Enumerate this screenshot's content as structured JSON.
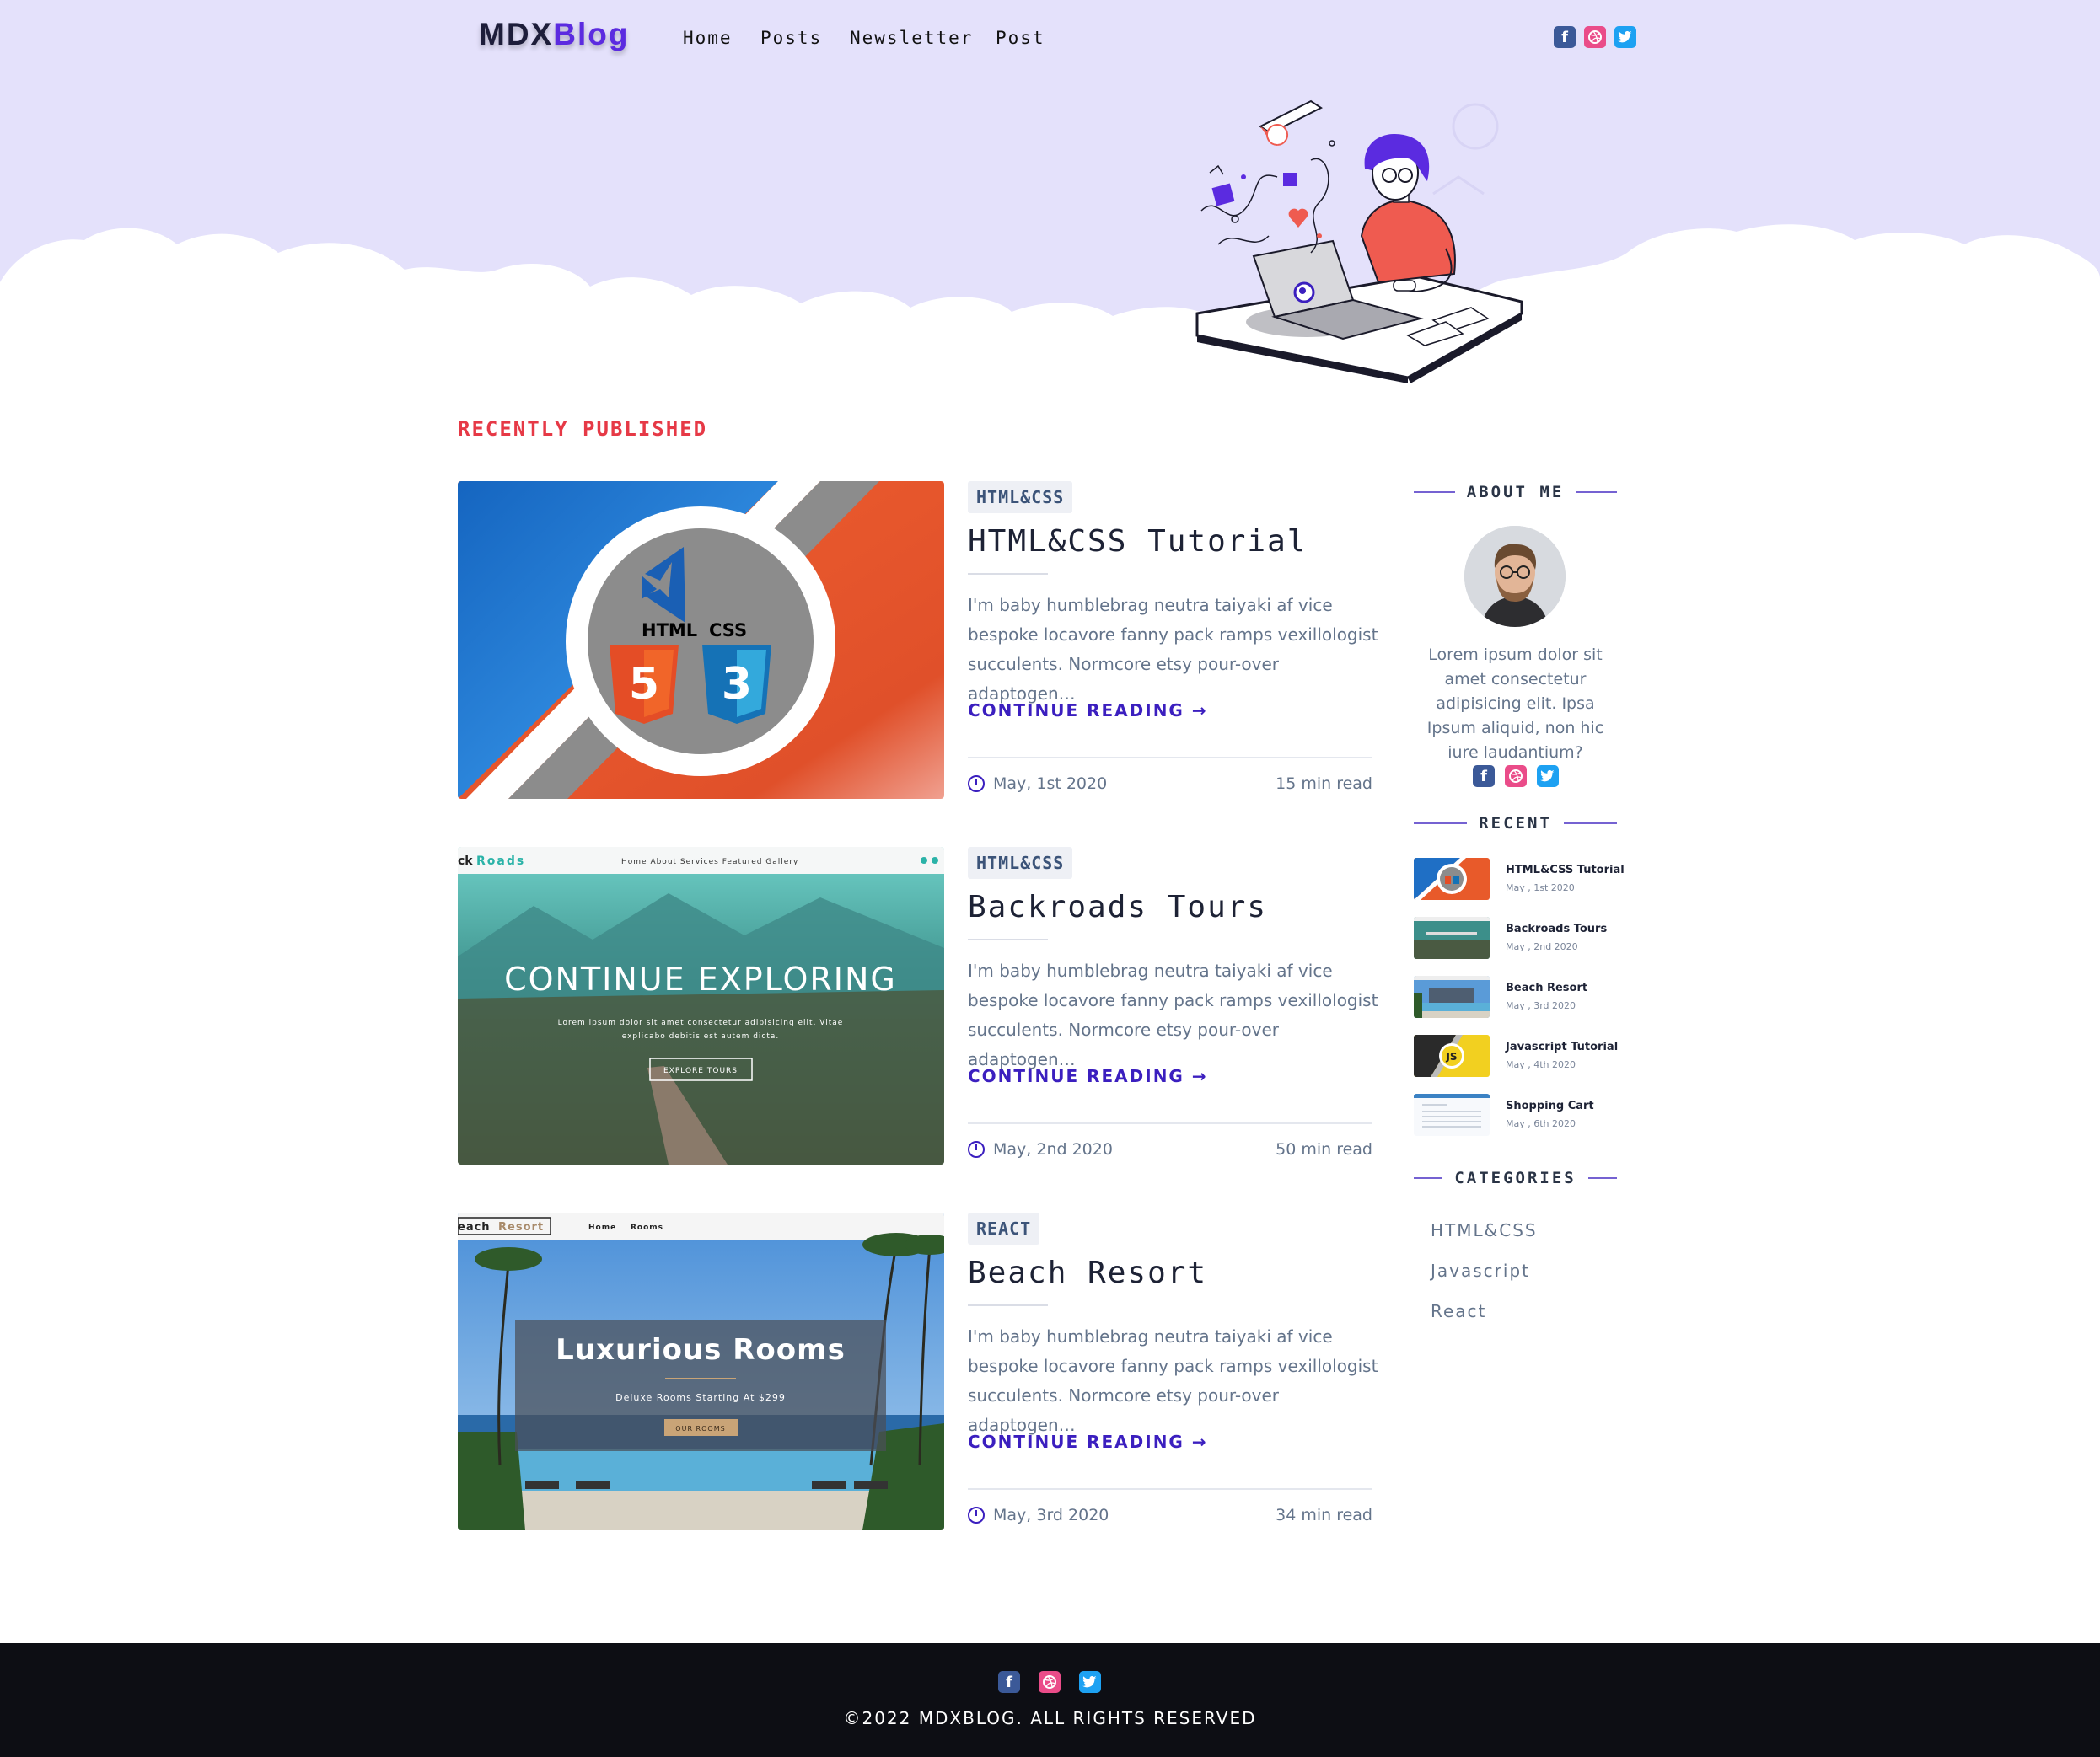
{
  "brand": {
    "part1": "MDX",
    "part2": "Blog"
  },
  "nav": [
    "Home",
    "Posts",
    "Newsletter",
    "Post"
  ],
  "header_social": [
    "facebook-icon",
    "dribbble-icon",
    "twitter-icon"
  ],
  "section_title": "RECENTLY PUBLISHED",
  "colors": {
    "accent": "#3b1fbf",
    "hero_bg": "#e4e1fb",
    "section_title": "#e63946",
    "footer_bg": "#0d0e14"
  },
  "posts": [
    {
      "tag": "HTML&CSS",
      "title": "HTML&CSS Tutorial",
      "excerpt": "I'm baby humblebrag neutra taiyaki af vice bespoke locavore fanny pack ramps vexillologist succulents. Normcore etsy pour-over adaptogen…",
      "cta": "CONTINUE READING",
      "date": "May, 1st 2020",
      "read": "15 min read",
      "thumb": {
        "html_label": "HTML",
        "css_label": "CSS",
        "html_num": "5",
        "css_num": "3"
      }
    },
    {
      "tag": "HTML&CSS",
      "title": "Backroads Tours",
      "excerpt": "I'm baby humblebrag neutra taiyaki af vice bespoke locavore fanny pack ramps vexillologist succulents. Normcore etsy pour-over adaptogen…",
      "cta": "CONTINUE READING",
      "date": "May, 2nd 2020",
      "read": "50 min read",
      "thumb": {
        "brand_a": "ck",
        "brand_b": "Roads",
        "nav": "Home  About  Services  Featured  Gallery",
        "headline": "CONTINUE EXPLORING",
        "sub1": "Lorem ipsum dolor sit amet consectetur adipisicing elit. Vitae",
        "sub2": "explicabo debitis est autem dicta.",
        "button": "EXPLORE TOURS"
      }
    },
    {
      "tag": "REACT",
      "title": "Beach Resort",
      "excerpt": "I'm baby humblebrag neutra taiyaki af vice bespoke locavore fanny pack ramps vexillologist succulents. Normcore etsy pour-over adaptogen…",
      "cta": "CONTINUE READING",
      "date": "May, 3rd 2020",
      "read": "34 min read",
      "thumb": {
        "brand_a": "each",
        "brand_b": "Resort",
        "nav1": "Home",
        "nav2": "Rooms",
        "headline": "Luxurious Rooms",
        "sub": "Deluxe Rooms Starting At $299",
        "button": "OUR ROOMS"
      }
    }
  ],
  "sidebar": {
    "about_title": "ABOUT ME",
    "about_text": "Lorem ipsum dolor sit amet consectetur adipisicing elit. Ipsa Ipsum aliquid, non hic iure laudantium?",
    "about_social": [
      "facebook-icon",
      "dribbble-icon",
      "twitter-icon"
    ],
    "recent_title": "RECENT",
    "recent": [
      {
        "title": "HTML&CSS Tutorial",
        "date": "May , 1st 2020"
      },
      {
        "title": "Backroads Tours",
        "date": "May , 2nd 2020"
      },
      {
        "title": "Beach Resort",
        "date": "May , 3rd 2020"
      },
      {
        "title": "Javascript Tutorial",
        "date": "May , 4th 2020",
        "badge": "JS"
      },
      {
        "title": "Shopping Cart",
        "date": "May , 6th 2020"
      }
    ],
    "categories_title": "CATEGORIES",
    "categories": [
      "HTML&CSS",
      "Javascript",
      "React"
    ]
  },
  "footer": {
    "copyright": "©2022 MDXBLOG. ALL RIGHTS RESERVED",
    "social": [
      "facebook-icon",
      "dribbble-icon",
      "twitter-icon"
    ]
  }
}
